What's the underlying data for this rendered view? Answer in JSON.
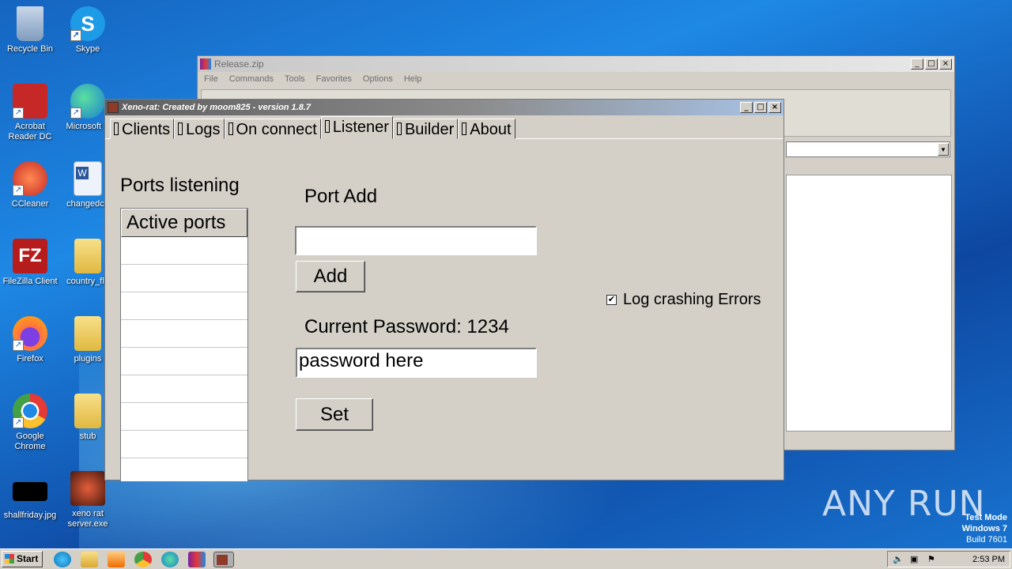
{
  "desktop": {
    "icons": [
      {
        "label": "Recycle Bin",
        "icon": "recycle-bin-icon",
        "color": "#9fb8d6"
      },
      {
        "label": "Skype",
        "icon": "skype-icon",
        "color": "#1e9be6"
      },
      {
        "label": "Acrobat Reader DC",
        "icon": "acrobat-icon",
        "color": "#c62828"
      },
      {
        "label": "Microsoft E",
        "icon": "edge-icon",
        "color": "#2196c8"
      },
      {
        "label": "CCleaner",
        "icon": "ccleaner-icon",
        "color": "#d84315"
      },
      {
        "label": "changedca",
        "icon": "word-doc-icon",
        "color": "#e8eef8"
      },
      {
        "label": "FileZilla Client",
        "icon": "filezilla-icon",
        "color": "#b71c1c"
      },
      {
        "label": "country_fla",
        "icon": "folder-icon",
        "color": "#f2d479"
      },
      {
        "label": "Firefox",
        "icon": "firefox-icon",
        "color": "#ff7043"
      },
      {
        "label": "plugins",
        "icon": "folder-icon",
        "color": "#f2d479"
      },
      {
        "label": "Google Chrome",
        "icon": "chrome-icon",
        "color": "#4caf50"
      },
      {
        "label": "stub",
        "icon": "folder-icon",
        "color": "#f2d479"
      },
      {
        "label": "shallfriday.jpg",
        "icon": "image-file-icon",
        "color": "#000000"
      },
      {
        "label": "xeno rat server.exe",
        "icon": "exe-icon",
        "color": "#8e3b2a"
      }
    ]
  },
  "winrar": {
    "title": "Release.zip",
    "menu": [
      "File",
      "Commands",
      "Tools",
      "Favorites",
      "Options",
      "Help"
    ]
  },
  "xeno": {
    "title": "Xeno-rat: Created by moom825 - version 1.8.7",
    "tabs": [
      "Clients",
      "Logs",
      "On connect",
      "Listener",
      "Builder",
      "About"
    ],
    "active_tab": "Listener",
    "ports_listening_label": "Ports listening",
    "active_ports_header": "Active ports",
    "port_add_label": "Port Add",
    "port_input_value": "",
    "add_button": "Add",
    "current_password_label": "Current Password: 1234",
    "password_input_value": "password here",
    "set_button": "Set",
    "log_crashing_label": "Log crashing Errors",
    "log_crashing_checked": true
  },
  "taskbar": {
    "start_label": "Start",
    "clock": "2:53 PM"
  },
  "watermark": {
    "line1": "Test Mode",
    "line2": "Windows 7",
    "line3": "Build 7601",
    "brand": "ANY RUN"
  }
}
